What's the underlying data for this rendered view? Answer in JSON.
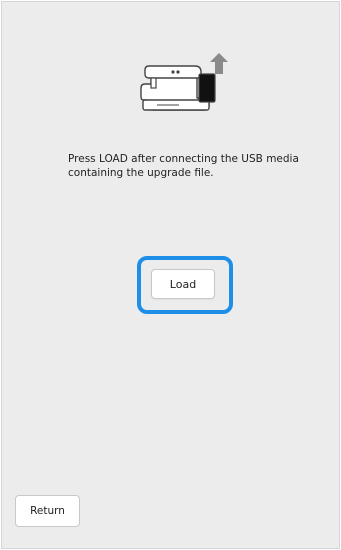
{
  "screen": {
    "background_color": "#ececec",
    "icon": "sewing-machine-upload-icon",
    "instruction": "Press LOAD after connecting the USB media\ncontaining the upgrade file.",
    "load_label": "Load",
    "return_label": "Return",
    "highlight_color": "#1e8fe8"
  }
}
